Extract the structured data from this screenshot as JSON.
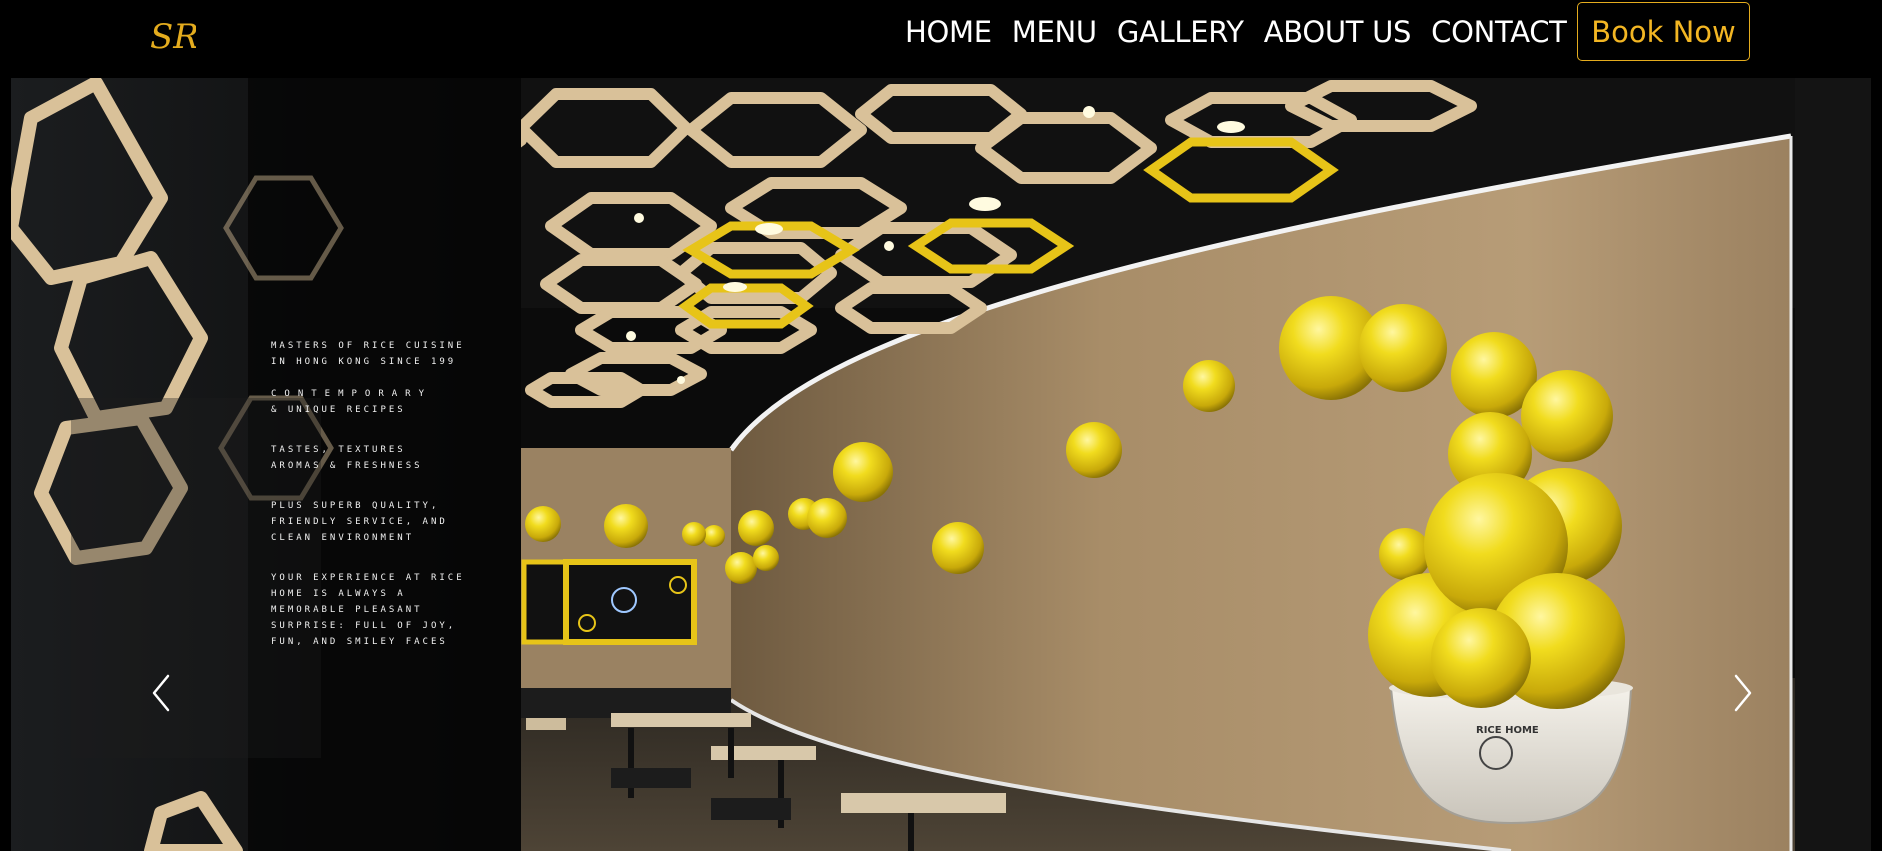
{
  "brand": {
    "logo_text": "SR",
    "accent_color": "#e4ac1e"
  },
  "nav": {
    "items": [
      {
        "label": "HOME"
      },
      {
        "label": "MENU"
      },
      {
        "label": "GALLERY"
      },
      {
        "label": "ABOUT US"
      },
      {
        "label": "CONTACT"
      }
    ],
    "book_label": "Book Now"
  },
  "hero": {
    "icons": {
      "prev": "chevron-left-icon",
      "next": "chevron-right-icon"
    },
    "wall_text": [
      "MASTERS OF RICE CUISINE",
      "IN HONG KONG SINCE 199",
      "CONTEMPORARY",
      "& UNIQUE RECIPES",
      "TASTES, TEXTURES",
      "AROMAS & FRESHNESS",
      "PLUS SUPERB QUALITY,",
      "FRIENDLY SERVICE, AND",
      "CLEAN ENVIRONMENT",
      "YOUR EXPERIENCE AT RICE",
      "HOME IS ALWAYS A",
      "MEMORABLE PLEASANT",
      "SURPRISE: FULL OF JOY,",
      "FUN, AND SMILEY FACES"
    ],
    "bowl_label": "RICE HOME"
  }
}
